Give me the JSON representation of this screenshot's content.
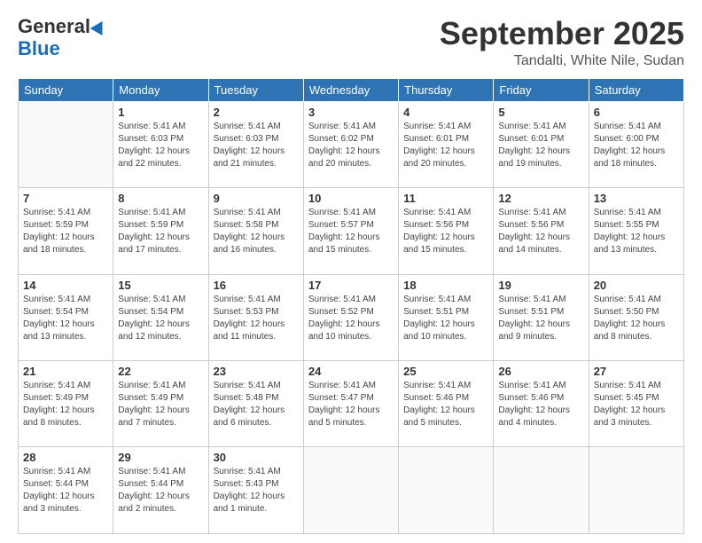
{
  "header": {
    "logo_general": "General",
    "logo_blue": "Blue",
    "month_title": "September 2025",
    "location": "Tandalti, White Nile, Sudan"
  },
  "days_of_week": [
    "Sunday",
    "Monday",
    "Tuesday",
    "Wednesday",
    "Thursday",
    "Friday",
    "Saturday"
  ],
  "weeks": [
    [
      {
        "day": "",
        "info": ""
      },
      {
        "day": "1",
        "info": "Sunrise: 5:41 AM\nSunset: 6:03 PM\nDaylight: 12 hours\nand 22 minutes."
      },
      {
        "day": "2",
        "info": "Sunrise: 5:41 AM\nSunset: 6:03 PM\nDaylight: 12 hours\nand 21 minutes."
      },
      {
        "day": "3",
        "info": "Sunrise: 5:41 AM\nSunset: 6:02 PM\nDaylight: 12 hours\nand 20 minutes."
      },
      {
        "day": "4",
        "info": "Sunrise: 5:41 AM\nSunset: 6:01 PM\nDaylight: 12 hours\nand 20 minutes."
      },
      {
        "day": "5",
        "info": "Sunrise: 5:41 AM\nSunset: 6:01 PM\nDaylight: 12 hours\nand 19 minutes."
      },
      {
        "day": "6",
        "info": "Sunrise: 5:41 AM\nSunset: 6:00 PM\nDaylight: 12 hours\nand 18 minutes."
      }
    ],
    [
      {
        "day": "7",
        "info": "Sunrise: 5:41 AM\nSunset: 5:59 PM\nDaylight: 12 hours\nand 18 minutes."
      },
      {
        "day": "8",
        "info": "Sunrise: 5:41 AM\nSunset: 5:59 PM\nDaylight: 12 hours\nand 17 minutes."
      },
      {
        "day": "9",
        "info": "Sunrise: 5:41 AM\nSunset: 5:58 PM\nDaylight: 12 hours\nand 16 minutes."
      },
      {
        "day": "10",
        "info": "Sunrise: 5:41 AM\nSunset: 5:57 PM\nDaylight: 12 hours\nand 15 minutes."
      },
      {
        "day": "11",
        "info": "Sunrise: 5:41 AM\nSunset: 5:56 PM\nDaylight: 12 hours\nand 15 minutes."
      },
      {
        "day": "12",
        "info": "Sunrise: 5:41 AM\nSunset: 5:56 PM\nDaylight: 12 hours\nand 14 minutes."
      },
      {
        "day": "13",
        "info": "Sunrise: 5:41 AM\nSunset: 5:55 PM\nDaylight: 12 hours\nand 13 minutes."
      }
    ],
    [
      {
        "day": "14",
        "info": "Sunrise: 5:41 AM\nSunset: 5:54 PM\nDaylight: 12 hours\nand 13 minutes."
      },
      {
        "day": "15",
        "info": "Sunrise: 5:41 AM\nSunset: 5:54 PM\nDaylight: 12 hours\nand 12 minutes."
      },
      {
        "day": "16",
        "info": "Sunrise: 5:41 AM\nSunset: 5:53 PM\nDaylight: 12 hours\nand 11 minutes."
      },
      {
        "day": "17",
        "info": "Sunrise: 5:41 AM\nSunset: 5:52 PM\nDaylight: 12 hours\nand 10 minutes."
      },
      {
        "day": "18",
        "info": "Sunrise: 5:41 AM\nSunset: 5:51 PM\nDaylight: 12 hours\nand 10 minutes."
      },
      {
        "day": "19",
        "info": "Sunrise: 5:41 AM\nSunset: 5:51 PM\nDaylight: 12 hours\nand 9 minutes."
      },
      {
        "day": "20",
        "info": "Sunrise: 5:41 AM\nSunset: 5:50 PM\nDaylight: 12 hours\nand 8 minutes."
      }
    ],
    [
      {
        "day": "21",
        "info": "Sunrise: 5:41 AM\nSunset: 5:49 PM\nDaylight: 12 hours\nand 8 minutes."
      },
      {
        "day": "22",
        "info": "Sunrise: 5:41 AM\nSunset: 5:49 PM\nDaylight: 12 hours\nand 7 minutes."
      },
      {
        "day": "23",
        "info": "Sunrise: 5:41 AM\nSunset: 5:48 PM\nDaylight: 12 hours\nand 6 minutes."
      },
      {
        "day": "24",
        "info": "Sunrise: 5:41 AM\nSunset: 5:47 PM\nDaylight: 12 hours\nand 5 minutes."
      },
      {
        "day": "25",
        "info": "Sunrise: 5:41 AM\nSunset: 5:46 PM\nDaylight: 12 hours\nand 5 minutes."
      },
      {
        "day": "26",
        "info": "Sunrise: 5:41 AM\nSunset: 5:46 PM\nDaylight: 12 hours\nand 4 minutes."
      },
      {
        "day": "27",
        "info": "Sunrise: 5:41 AM\nSunset: 5:45 PM\nDaylight: 12 hours\nand 3 minutes."
      }
    ],
    [
      {
        "day": "28",
        "info": "Sunrise: 5:41 AM\nSunset: 5:44 PM\nDaylight: 12 hours\nand 3 minutes."
      },
      {
        "day": "29",
        "info": "Sunrise: 5:41 AM\nSunset: 5:44 PM\nDaylight: 12 hours\nand 2 minutes."
      },
      {
        "day": "30",
        "info": "Sunrise: 5:41 AM\nSunset: 5:43 PM\nDaylight: 12 hours\nand 1 minute."
      },
      {
        "day": "",
        "info": ""
      },
      {
        "day": "",
        "info": ""
      },
      {
        "day": "",
        "info": ""
      },
      {
        "day": "",
        "info": ""
      }
    ]
  ]
}
